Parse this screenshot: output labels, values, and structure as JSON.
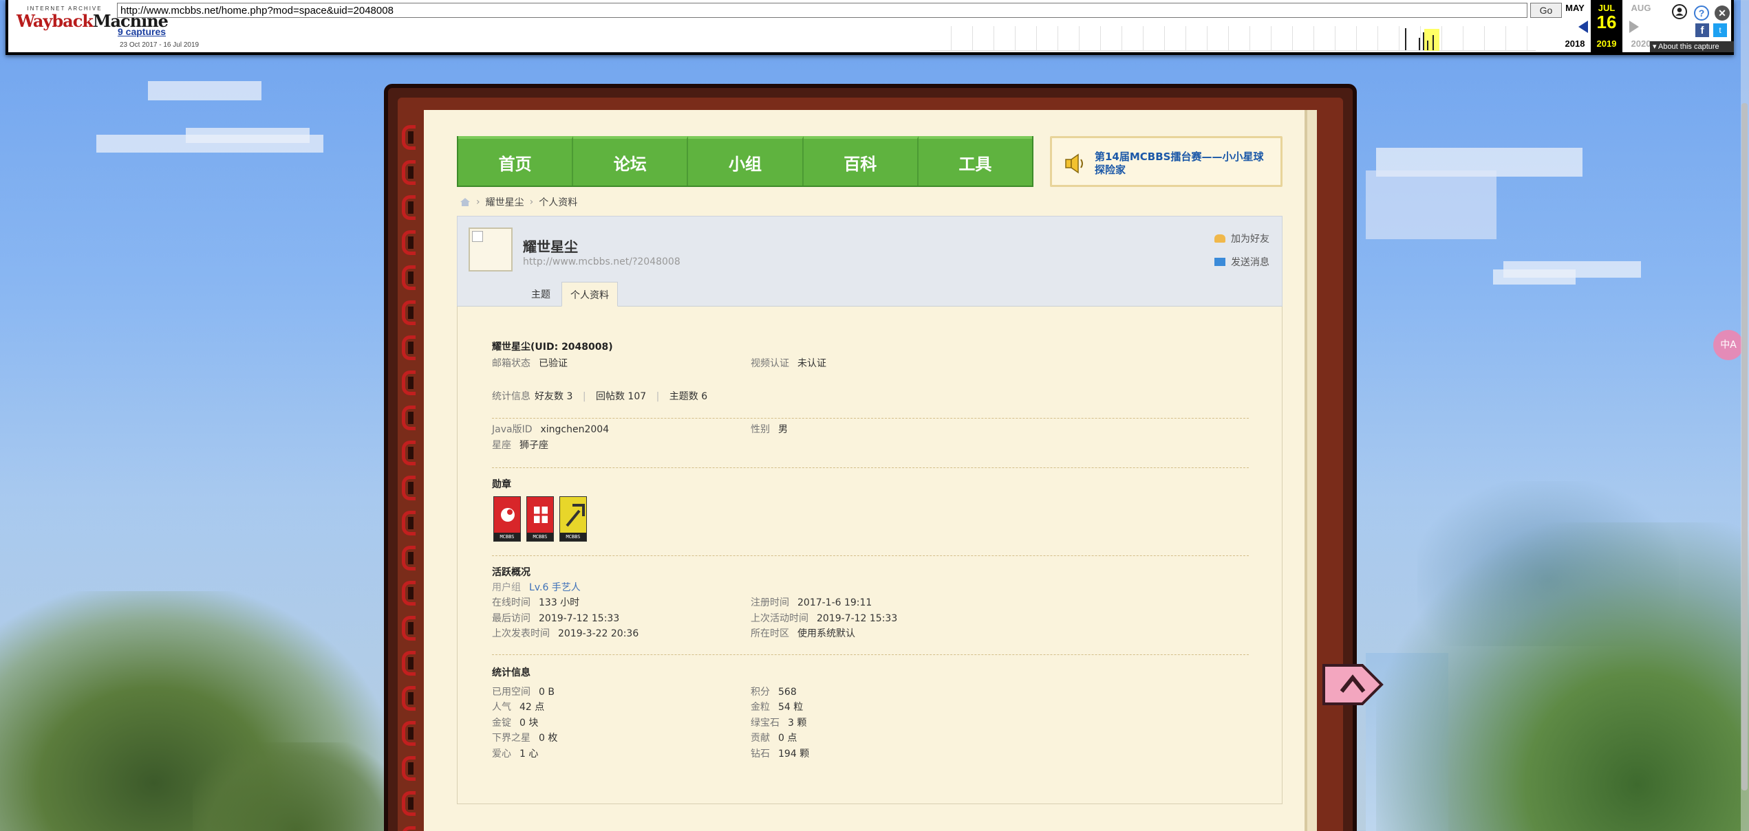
{
  "wayback": {
    "logo_top": "INTERNET ARCHIVE",
    "logo_wayback": "Wayback",
    "logo_machine": "Machine",
    "url": "http://www.mcbbs.net/home.php?mod=space&uid=2048008",
    "go_label": "Go",
    "captures_label": "9 captures",
    "date_range": "23 Oct 2017 - 16 Jul 2019",
    "prev_month": "MAY",
    "prev_year": "2018",
    "cur_month": "JUL",
    "cur_day": "16",
    "cur_year": "2019",
    "next_month": "AUG",
    "next_year": "2020",
    "about_label": "About this capture",
    "help_glyph": "?",
    "close_glyph": "✕",
    "fb_glyph": "f",
    "tw_glyph": "t"
  },
  "nav": {
    "items": [
      {
        "label": "首页"
      },
      {
        "label": "论坛"
      },
      {
        "label": "小组"
      },
      {
        "label": "百科"
      },
      {
        "label": "工具"
      }
    ]
  },
  "notice": {
    "text": "第14届MCBBS擂台赛——小小星球探险家"
  },
  "breadcrumb": {
    "items": [
      "耀世星尘",
      "个人资料"
    ],
    "separator": "›"
  },
  "profile": {
    "username": "耀世星尘",
    "url": "http://www.mcbbs.net/?2048008",
    "add_friend": "加为好友",
    "send_message": "发送消息",
    "tabs": [
      {
        "label": "主题",
        "active": false
      },
      {
        "label": "个人资料",
        "active": true
      }
    ]
  },
  "details": {
    "name_uid": "耀世星尘(UID: 2048008)",
    "email_label": "邮箱状态",
    "email_value": "已验证",
    "video_label": "视频认证",
    "video_value": "未认证",
    "stats_label": "统计信息",
    "friends": "好友数 3",
    "replies": "回帖数 107",
    "threads": "主题数 6",
    "stat_sep": "|",
    "java_label": "Java版ID",
    "java_value": "xingchen2004",
    "gender_label": "性别",
    "gender_value": "男",
    "zodiac_label": "星座",
    "zodiac_value": "狮子座",
    "medals_title": "勋章",
    "medal_caption": "MCBBS",
    "activity_title": "活跃概况",
    "usergroup_label": "用户组",
    "usergroup_value": "Lv.6 手艺人",
    "online_label": "在线时间",
    "online_value": "133 小时",
    "register_label": "注册时间",
    "register_value": "2017-1-6 19:11",
    "lastvisit_label": "最后访问",
    "lastvisit_value": "2019-7-12 15:33",
    "lastactive_label": "上次活动时间",
    "lastactive_value": "2019-7-12 15:33",
    "lastpost_label": "上次发表时间",
    "lastpost_value": "2019-3-22 20:36",
    "timezone_label": "所在时区",
    "timezone_value": "使用系统默认",
    "stats_title": "统计信息",
    "space_label": "已用空间",
    "space_value": "0 B",
    "points_label": "积分",
    "points_value": "568",
    "popularity_label": "人气",
    "popularity_value": "42 点",
    "gold_label": "金粒",
    "gold_value": "54 粒",
    "ingot_label": "金锭",
    "ingot_value": "0 块",
    "emerald_label": "绿宝石",
    "emerald_value": "3 颗",
    "nether_label": "下界之星",
    "nether_value": "0 枚",
    "contrib_label": "贡献",
    "contrib_value": "0 点",
    "love_label": "爱心",
    "love_value": "1 心",
    "diamond_label": "钻石",
    "diamond_value": "194 颗"
  },
  "translate_button": "中A",
  "colors": {
    "nav_green": "#5fb33f",
    "book_brown": "#7a2c1a",
    "page_cream": "#faf3dc",
    "link_blue": "#3c6fb8",
    "notice_blue": "#1b58a8"
  }
}
